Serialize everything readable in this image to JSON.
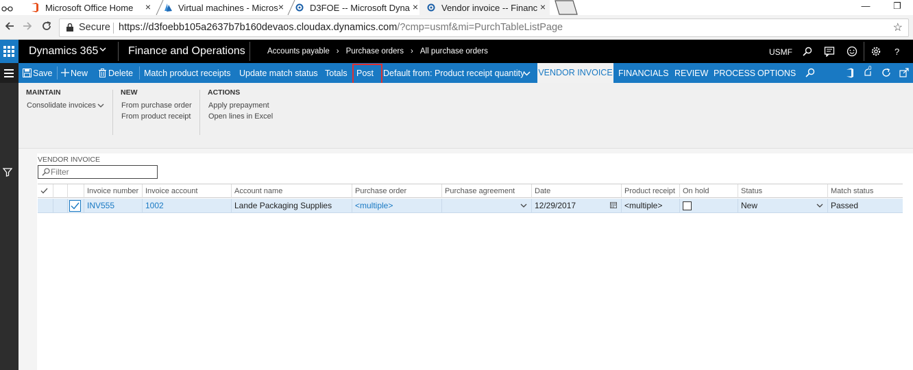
{
  "browser": {
    "tabs": [
      {
        "title": "Microsoft Office Home",
        "close": "×"
      },
      {
        "title": "Virtual machines - Micros",
        "close": "×"
      },
      {
        "title": "D3FOE -- Microsoft Dyna",
        "close": "×"
      },
      {
        "title": "Vendor invoice -- Financ",
        "close": "×"
      }
    ],
    "secure_label": "Secure",
    "url_host": "https://d3foebb105a2637b7b160devaos.cloudax.dynamics.com",
    "url_path": "/?cmp=usmf&mi=PurchTableListPage",
    "window_controls": {
      "minimize": "—",
      "maximize": "❐"
    }
  },
  "navbar": {
    "brand": "Dynamics 365",
    "app_name": "Finance and Operations",
    "breadcrumbs": [
      "Accounts payable",
      "Purchase orders",
      "All purchase orders"
    ],
    "breadcrumb_sep": "›",
    "company": "USMF",
    "icons": [
      "search-icon",
      "message-icon",
      "smiley-icon",
      "settings-icon",
      "help-icon"
    ],
    "help_label": "?"
  },
  "actionbar": {
    "save": "Save",
    "new": "New",
    "delete": "Delete",
    "match_product_receipts": "Match product receipts",
    "update_match_status": "Update match status",
    "totals": "Totals",
    "post": "Post",
    "default_from": "Default from: Product receipt quantity",
    "tabs": [
      "VENDOR INVOICE",
      "FINANCIALS",
      "REVIEW",
      "PROCESS",
      "OPTIONS"
    ],
    "notification_count": "0",
    "accent_color": "#1979c3",
    "highlight_color": "#e03131"
  },
  "ribbon": {
    "maintain": {
      "title": "MAINTAIN",
      "items": [
        "Consolidate invoices"
      ]
    },
    "new": {
      "title": "NEW",
      "items": [
        "From purchase order",
        "From product receipt"
      ]
    },
    "actions": {
      "title": "ACTIONS",
      "items": [
        "Apply prepayment",
        "Open lines in Excel"
      ]
    }
  },
  "content": {
    "section_label": "VENDOR INVOICE",
    "filter_placeholder": "Filter",
    "columns": [
      "Invoice number",
      "Invoice account",
      "Account name",
      "Purchase order",
      "Purchase agreement",
      "Date",
      "Product receipt",
      "On hold",
      "Status",
      "Match status"
    ],
    "rows": [
      {
        "invoice_number": "INV555",
        "invoice_account": "1002",
        "account_name": "Lande Packaging Supplies",
        "purchase_order": "<multiple>",
        "purchase_agreement": "",
        "date": "12/29/2017",
        "product_receipt": "<multiple>",
        "on_hold": false,
        "status": "New",
        "match_status": "Passed"
      }
    ]
  }
}
